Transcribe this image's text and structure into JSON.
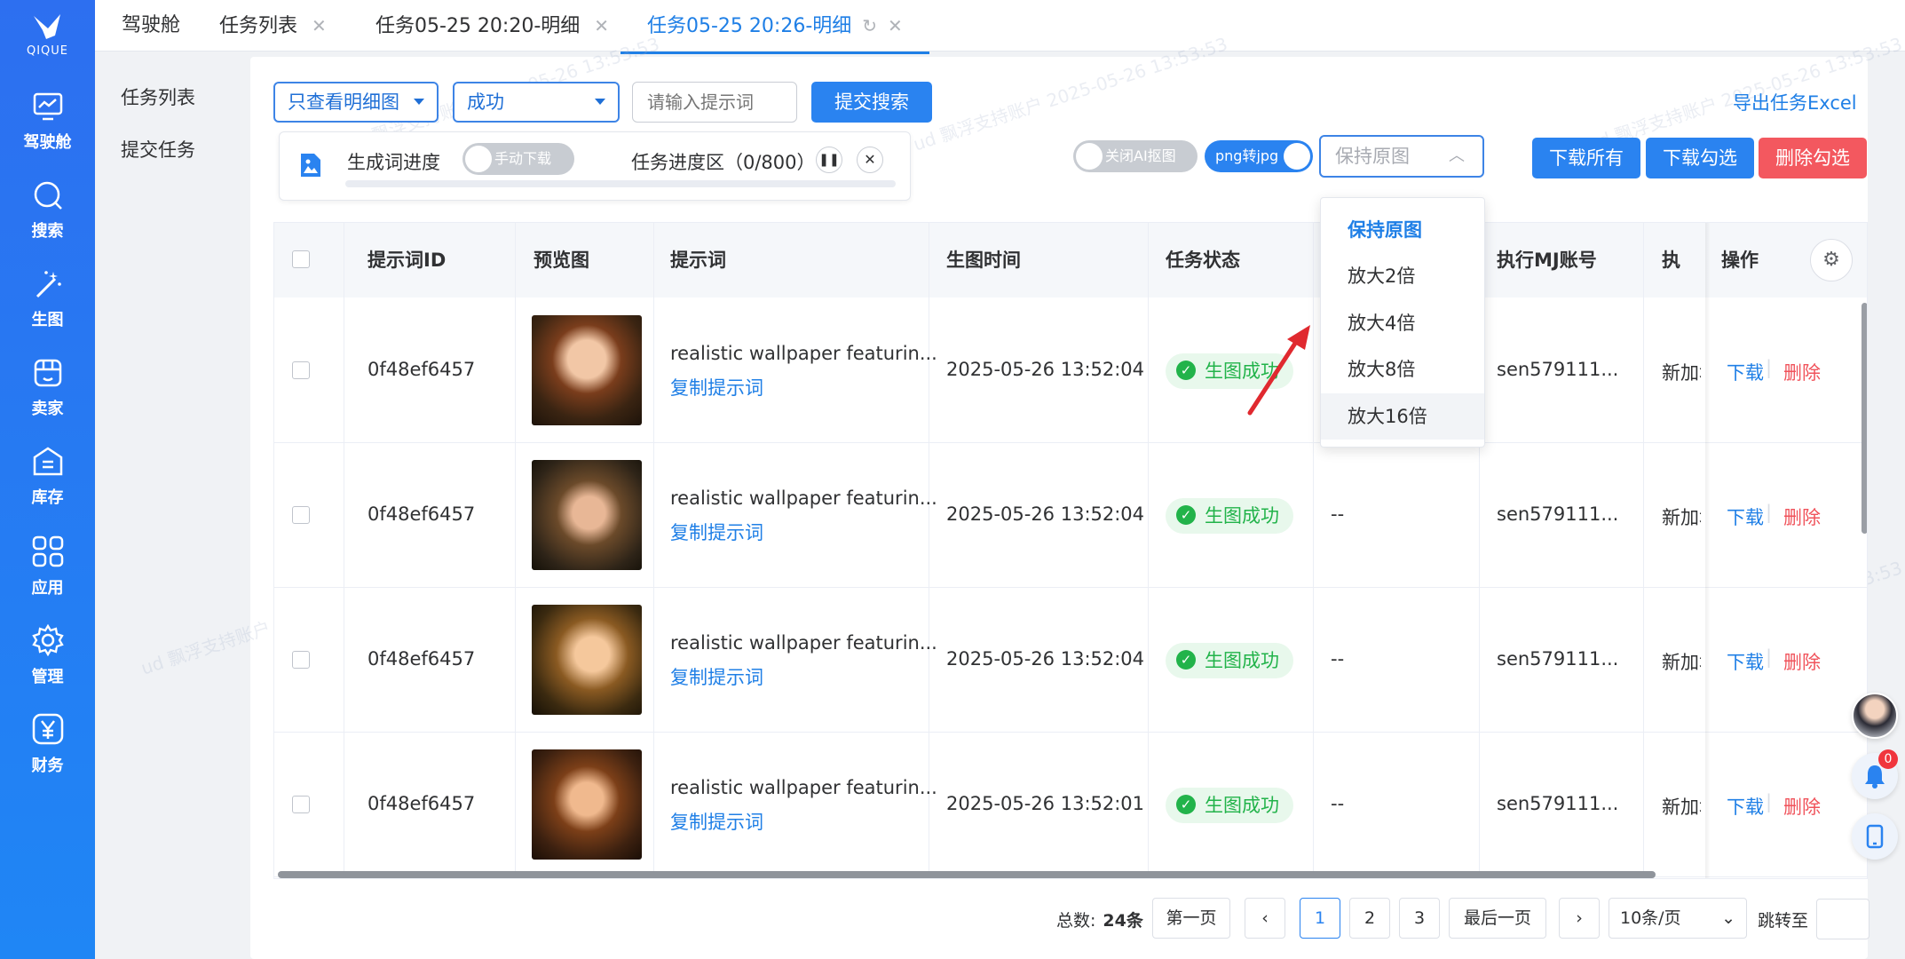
{
  "sidebar": {
    "logo_text": "QIQUE",
    "items": [
      {
        "label": "驾驶舱",
        "icon": "dashboard-icon"
      },
      {
        "label": "搜索",
        "icon": "search-icon"
      },
      {
        "label": "生图",
        "icon": "magic-wand-icon"
      },
      {
        "label": "卖家",
        "icon": "store-icon"
      },
      {
        "label": "库存",
        "icon": "inventory-icon"
      },
      {
        "label": "应用",
        "icon": "apps-grid-icon"
      },
      {
        "label": "管理",
        "icon": "gear-icon"
      },
      {
        "label": "财务",
        "icon": "yuan-icon"
      }
    ]
  },
  "tabs": [
    {
      "label": "驾驶舱"
    },
    {
      "label": "任务列表"
    },
    {
      "label": "任务05-25 20:20-明细"
    },
    {
      "label": "任务05-25 20:26-明细"
    }
  ],
  "left_menu": {
    "items": [
      "任务列表",
      "提交任务"
    ]
  },
  "filters": {
    "view_select": "只查看明细图",
    "status_select": "成功",
    "keyword_placeholder": "请输入提示词",
    "submit_search": "提交搜索",
    "export_excel": "导出任务Excel"
  },
  "progress_box": {
    "word_progress_label": "生成词进度",
    "manual_download_toggle": "手动下载",
    "task_progress_label": "任务进度区（0/800）",
    "progress_fraction": 0
  },
  "toolbar": {
    "ai_cutout_toggle": "关闭AI抠图",
    "png_to_jpg_toggle": "png转jpg",
    "scale_select": "保持原图",
    "download_all": "下载所有",
    "download_checked": "下载勾选",
    "delete_checked": "删除勾选"
  },
  "scale_dropdown": {
    "options": [
      "保持原图",
      "放大2倍",
      "放大4倍",
      "放大8倍",
      "放大16倍"
    ],
    "selected": "保持原图",
    "hovered": "放大16倍"
  },
  "table": {
    "headers": [
      "提示词ID",
      "预览图",
      "提示词",
      "生图时间",
      "任务状态",
      "执行MJ账号",
      "执行",
      "操作"
    ],
    "rows": [
      {
        "id": "0f48ef6457",
        "prompt": "realistic wallpaper featurin...",
        "copy": "复制提示词",
        "time": "2025-05-26 13:52:04",
        "status": "生图成功",
        "col6": "--",
        "account": "sen579111...",
        "exec": "新加坡",
        "download": "下载",
        "delete": "删除"
      },
      {
        "id": "0f48ef6457",
        "prompt": "realistic wallpaper featurin...",
        "copy": "复制提示词",
        "time": "2025-05-26 13:52:04",
        "status": "生图成功",
        "col6": "--",
        "account": "sen579111...",
        "exec": "新加坡",
        "download": "下载",
        "delete": "删除"
      },
      {
        "id": "0f48ef6457",
        "prompt": "realistic wallpaper featurin...",
        "copy": "复制提示词",
        "time": "2025-05-26 13:52:04",
        "status": "生图成功",
        "col6": "--",
        "account": "sen579111...",
        "exec": "新加坡",
        "download": "下载",
        "delete": "删除"
      },
      {
        "id": "0f48ef6457",
        "prompt": "realistic wallpaper featurin...",
        "copy": "复制提示词",
        "time": "2025-05-26 13:52:01",
        "status": "生图成功",
        "col6": "--",
        "account": "sen579111...",
        "exec": "新加坡",
        "download": "下载",
        "delete": "删除"
      }
    ]
  },
  "pagination": {
    "total_label": "总数:",
    "total_value": "24条",
    "first": "第一页",
    "pages": [
      "1",
      "2",
      "3"
    ],
    "current": "1",
    "last": "最后一页",
    "page_size": "10条/页",
    "jump_label": "跳转至"
  },
  "notifications": {
    "count": "0"
  },
  "colors": {
    "primary": "#2a83f0",
    "danger": "#f3585f",
    "success": "#22b34a",
    "sidebar": "#2d6ff0"
  }
}
